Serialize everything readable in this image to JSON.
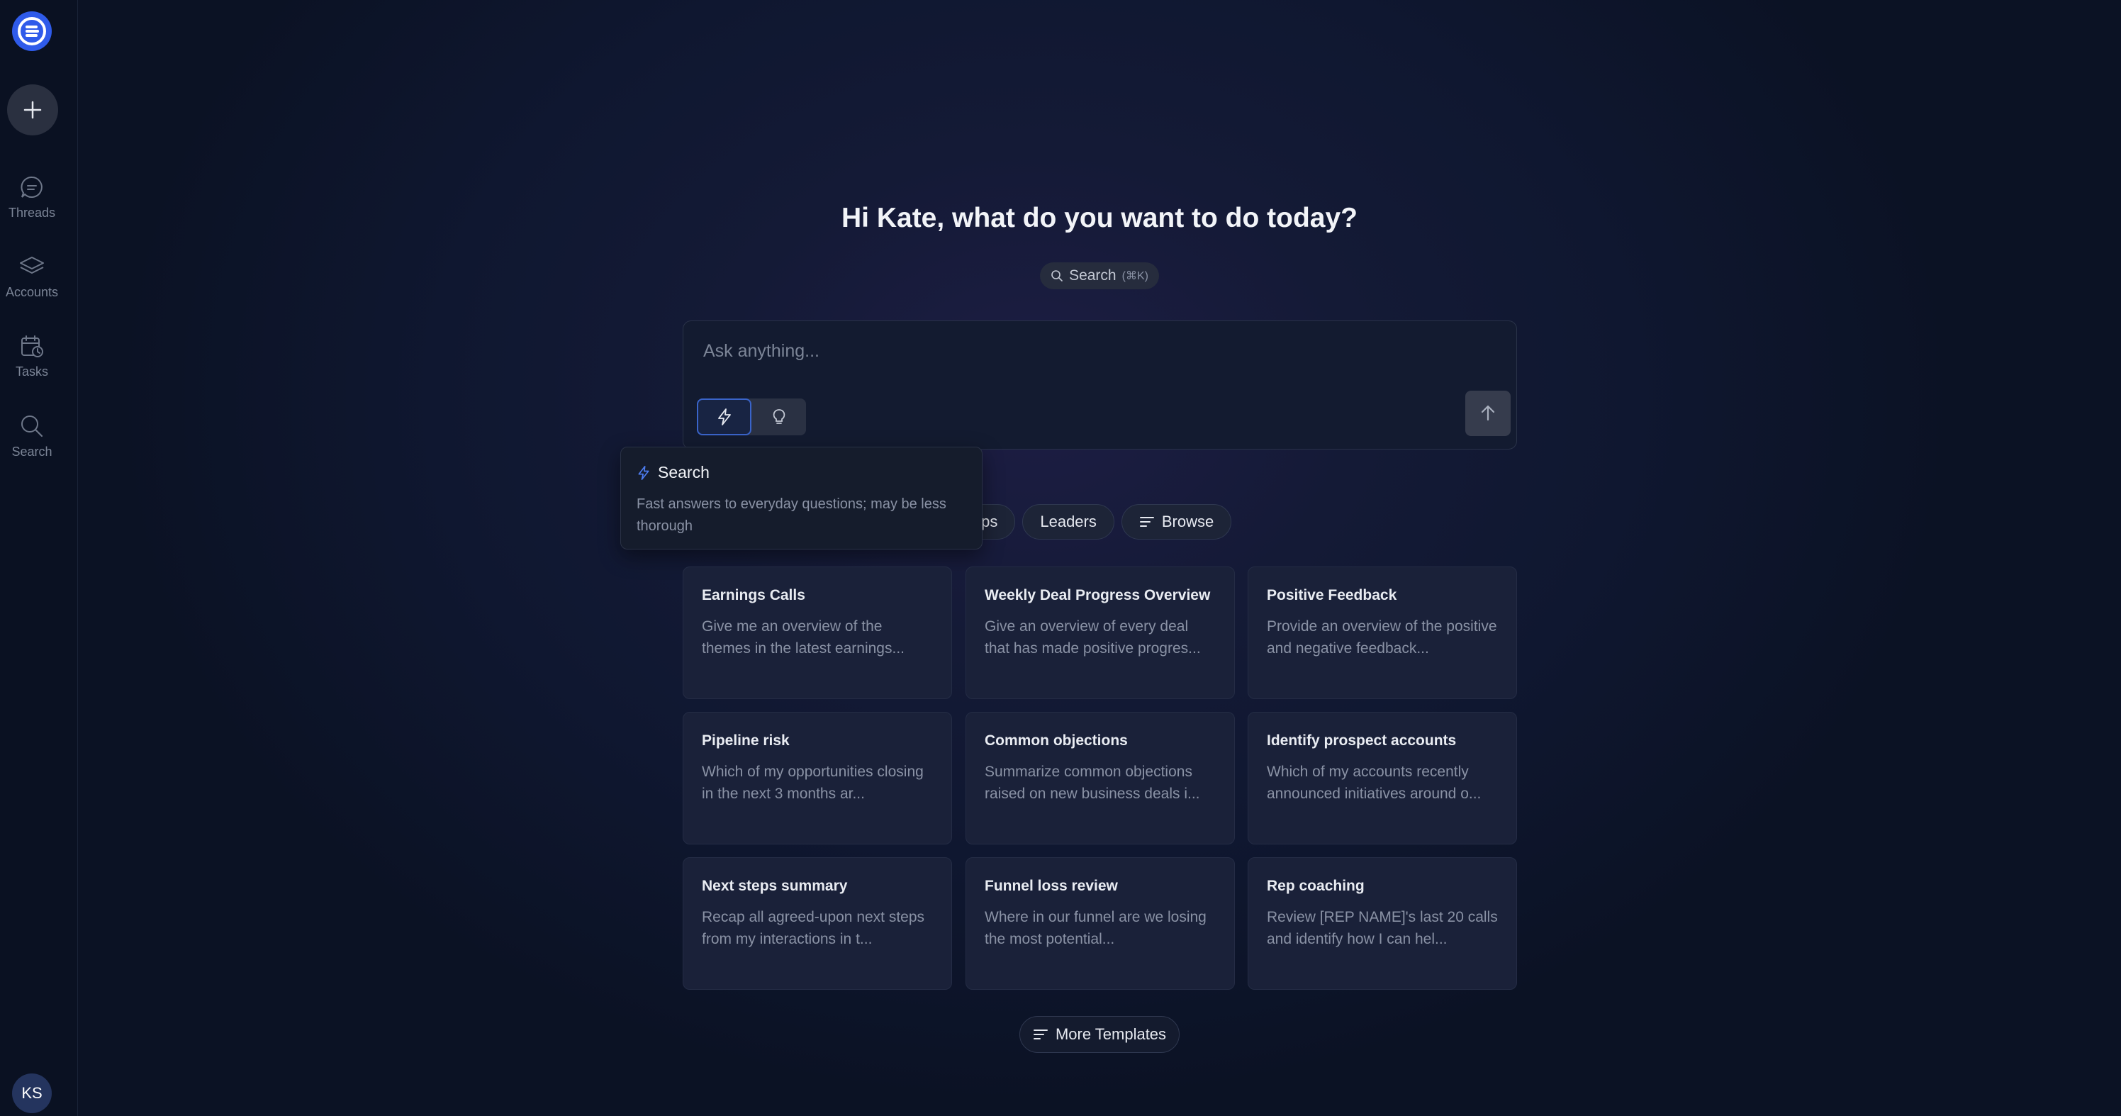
{
  "sidebar": {
    "logo_icon": "app-logo-icon",
    "new_icon": "plus-icon",
    "items": [
      {
        "label": "Threads",
        "icon": "chat-bubble-icon"
      },
      {
        "label": "Accounts",
        "icon": "layers-icon"
      },
      {
        "label": "Tasks",
        "icon": "calendar-clock-icon"
      },
      {
        "label": "Search",
        "icon": "search-icon"
      }
    ],
    "avatar_initials": "KS"
  },
  "main": {
    "greeting": "Hi Kate, what do you want to do today?",
    "search_pill": {
      "label": "Search",
      "shortcut": "(⌘K)"
    },
    "ask": {
      "placeholder": "Ask anything...",
      "modes": [
        {
          "icon": "lightning-icon",
          "active": true
        },
        {
          "icon": "lightbulb-icon",
          "active": false
        }
      ],
      "send_icon": "arrow-up-icon"
    },
    "tooltip": {
      "title": "Search",
      "description": "Fast answers to everyday questions; may be less thorough"
    },
    "chips": [
      {
        "label": "Ops"
      },
      {
        "label": "Leaders"
      },
      {
        "label": "Browse",
        "icon": "list-filter-icon"
      }
    ],
    "templates": [
      {
        "title": "Earnings Calls",
        "description": "Give me an overview of the themes in the latest earnings..."
      },
      {
        "title": "Weekly Deal Progress Overview",
        "description": "Give an overview of every deal that has made positive progres..."
      },
      {
        "title": "Positive Feedback",
        "description": "Provide an overview of the positive and negative feedback..."
      },
      {
        "title": "Pipeline risk",
        "description": "Which of my opportunities closing in the next 3 months ar..."
      },
      {
        "title": "Common objections",
        "description": "Summarize common objections raised on new business deals i..."
      },
      {
        "title": "Identify prospect accounts",
        "description": "Which of my accounts recently announced initiatives around o..."
      },
      {
        "title": "Next steps summary",
        "description": "Recap all agreed-upon next steps from my interactions in t..."
      },
      {
        "title": "Funnel loss review",
        "description": "Where in our funnel are we losing the most potential..."
      },
      {
        "title": "Rep coaching",
        "description": "Review [REP NAME]'s last 20 calls and identify how I can hel..."
      }
    ],
    "more_templates_label": "More Templates"
  }
}
